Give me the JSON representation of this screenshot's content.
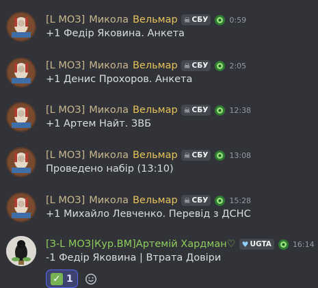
{
  "messages": [
    {
      "name_prefix": "[L  МОЗ]",
      "name_main": "Микола",
      "name_suffix": "Вельмар",
      "tag": "СБУ",
      "time": "0:59",
      "text": "+1 Федір Яковина. Анкета"
    },
    {
      "name_prefix": "[L  МОЗ]",
      "name_main": "Микола",
      "name_suffix": "Вельмар",
      "tag": "СБУ",
      "time": "2:05",
      "text": "+1 Денис Прохоров. Анкета"
    },
    {
      "name_prefix": "[L  МОЗ]",
      "name_main": "Микола",
      "name_suffix": "Вельмар",
      "tag": "СБУ",
      "time": "12:38",
      "text": "+1 Артем Найт. ЗВБ"
    },
    {
      "name_prefix": "[L  МОЗ]",
      "name_main": "Микола",
      "name_suffix": "Вельмар",
      "tag": "СБУ",
      "time": "13:08",
      "text": "Проведено набір (13:10)"
    },
    {
      "name_prefix": "[L  МОЗ]",
      "name_main": "Микола",
      "name_suffix": "Вельмар",
      "tag": "СБУ",
      "time": "15:28",
      "text": "+1 Михайло Левченко. Перевід з ДСНС"
    },
    {
      "name_full": "[З-L МОЗ|Кур.ВМ]Артемій Хардман♡",
      "tag": "UGTA",
      "time": "16:14",
      "text": "-1 Федір Яковина | Втрата Довіри"
    }
  ],
  "reaction": {
    "emoji": "✓",
    "count": "1"
  },
  "icons": {
    "tag_icon_1": "skull-icon",
    "tag_icon_2": "heart-icon",
    "badge": "green-badge-icon",
    "add_reaction": "smile-plus-icon"
  },
  "colors": {
    "background": "#313338",
    "name_prefix": "#cbb88f",
    "name_suffix": "#e9c45a",
    "name_green": "#8fce5c",
    "timestamp": "#949ba4",
    "reaction_bg": "#3d4270",
    "reaction_border": "#5865f2"
  }
}
